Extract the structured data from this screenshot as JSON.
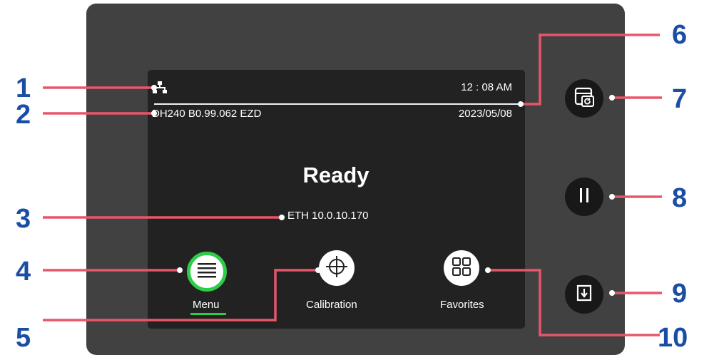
{
  "status": {
    "network_icon": "ethernet-network-icon",
    "time": "12 : 08 AM",
    "firmware": "DH240 B0.99.062 EZD",
    "date": "2023/05/08"
  },
  "main": {
    "status_text": "Ready",
    "connection": "ETH 10.0.10.170"
  },
  "bottom_nav": [
    {
      "label": "Menu",
      "icon": "hamburger-menu-icon",
      "selected": true
    },
    {
      "label": "Calibration",
      "icon": "crosshair-icon"
    },
    {
      "label": "Favorites",
      "icon": "grid-icon"
    }
  ],
  "side_buttons": [
    {
      "icon": "print-reload-icon"
    },
    {
      "icon": "pause-icon"
    },
    {
      "icon": "feed-icon"
    }
  ],
  "callouts": [
    "1",
    "2",
    "3",
    "4",
    "5",
    "6",
    "7",
    "8",
    "9",
    "10"
  ],
  "colors": {
    "callout_text": "#1a4ea5",
    "leader_line": "#e8566b",
    "selection_accent": "#2ecc49",
    "device_body": "#414141",
    "screen": "#222222"
  }
}
